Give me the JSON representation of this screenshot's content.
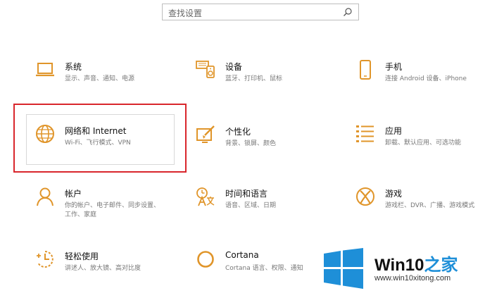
{
  "search": {
    "placeholder": "查找设置",
    "icon": "search-icon"
  },
  "accent_color": "#e0952a",
  "highlight_color": "#d9262c",
  "items": [
    {
      "title": "系统",
      "desc": "显示、声音、通知、电源",
      "icon": "laptop-icon"
    },
    {
      "title": "设备",
      "desc": "蓝牙、打印机、鼠标",
      "icon": "keyboard-speaker-icon"
    },
    {
      "title": "手机",
      "desc": "连接 Android 设备、iPhone",
      "icon": "phone-icon"
    },
    {
      "title": "网络和 Internet",
      "desc": "Wi-Fi、飞行模式、VPN",
      "icon": "globe-icon"
    },
    {
      "title": "个性化",
      "desc": "背景、锁屏、颜色",
      "icon": "paint-brush-icon"
    },
    {
      "title": "应用",
      "desc": "卸载、默认应用、可选功能",
      "icon": "apps-list-icon"
    },
    {
      "title": "帐户",
      "desc": "你的帐户、电子邮件、同步设置、",
      "desc2": "工作、家庭",
      "icon": "person-icon"
    },
    {
      "title": "时间和语言",
      "desc": "语音、区域、日期",
      "icon": "time-language-icon"
    },
    {
      "title": "游戏",
      "desc": "游戏栏、DVR、广播、游戏模式",
      "icon": "xbox-icon"
    },
    {
      "title": "轻松使用",
      "desc": "讲述人、放大镜、高对比度",
      "icon": "ease-of-access-icon"
    },
    {
      "title": "Cortana",
      "desc": "Cortana 语言、权限、通知",
      "icon": "cortana-icon"
    }
  ],
  "watermark": {
    "title_a": "Win10",
    "title_b": "之家",
    "url": "www.win10xitong.com",
    "logo": "windows-logo-icon",
    "blue": "#1e8fd8"
  }
}
